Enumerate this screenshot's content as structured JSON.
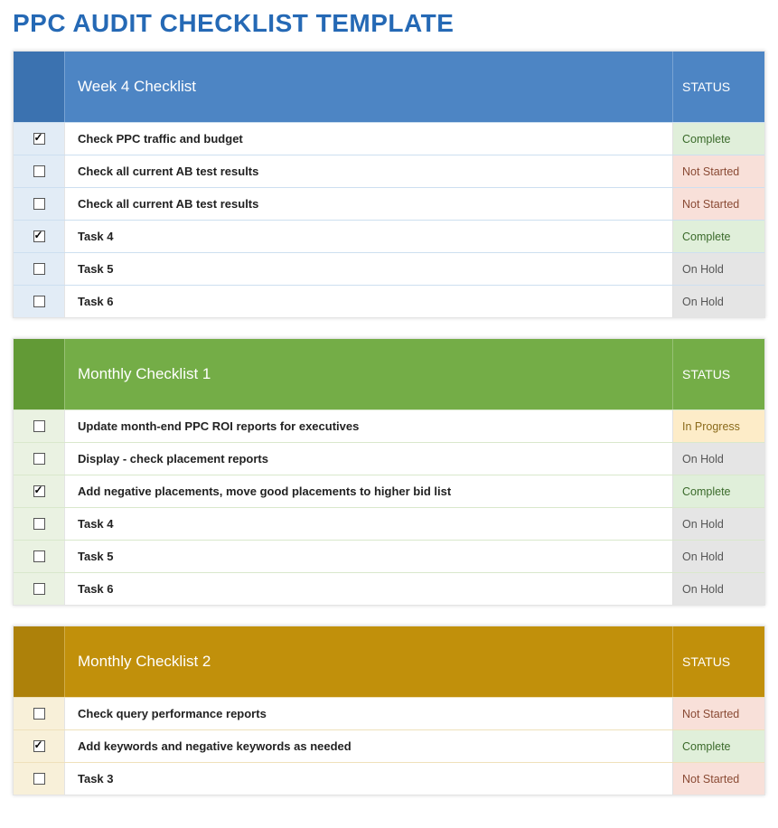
{
  "page_title": "PPC AUDIT CHECKLIST TEMPLATE",
  "status_header": "STATUS",
  "status_labels": {
    "complete": "Complete",
    "not_started": "Not Started",
    "on_hold": "On Hold",
    "in_progress": "In Progress"
  },
  "sections": [
    {
      "title": "Week 4 Checklist",
      "theme": "blue",
      "rows": [
        {
          "checked": true,
          "task": "Check PPC traffic and budget",
          "status": "complete"
        },
        {
          "checked": false,
          "task": "Check all current AB test results",
          "status": "not_started"
        },
        {
          "checked": false,
          "task": "Check all current AB test results",
          "status": "not_started"
        },
        {
          "checked": true,
          "task": "Task 4",
          "status": "complete"
        },
        {
          "checked": false,
          "task": "Task 5",
          "status": "on_hold"
        },
        {
          "checked": false,
          "task": "Task 6",
          "status": "on_hold"
        }
      ]
    },
    {
      "title": "Monthly Checklist 1",
      "theme": "green",
      "rows": [
        {
          "checked": false,
          "task": "Update month-end PPC ROI reports for executives",
          "status": "in_progress"
        },
        {
          "checked": false,
          "task": "Display - check placement reports",
          "status": "on_hold"
        },
        {
          "checked": true,
          "task": "Add negative placements, move good placements to higher bid list",
          "status": "complete"
        },
        {
          "checked": false,
          "task": "Task 4",
          "status": "on_hold"
        },
        {
          "checked": false,
          "task": "Task 5",
          "status": "on_hold"
        },
        {
          "checked": false,
          "task": "Task 6",
          "status": "on_hold"
        }
      ]
    },
    {
      "title": "Monthly Checklist 2",
      "theme": "gold",
      "rows": [
        {
          "checked": false,
          "task": "Check query performance reports",
          "status": "not_started"
        },
        {
          "checked": true,
          "task": "Add keywords and negative keywords as needed",
          "status": "complete"
        },
        {
          "checked": false,
          "task": "Task 3",
          "status": "not_started"
        }
      ]
    }
  ]
}
